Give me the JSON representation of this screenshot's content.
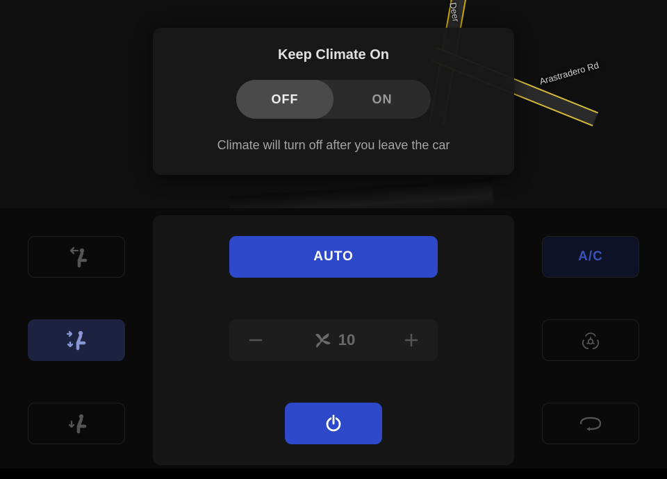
{
  "map": {
    "road1_label": "Deer",
    "road2_label": "Arastradero Rd"
  },
  "dialog": {
    "title": "Keep Climate On",
    "off_label": "OFF",
    "on_label": "ON",
    "selected": "off",
    "description": "Climate will turn off after you leave the car"
  },
  "climate": {
    "auto_label": "AUTO",
    "ac_label": "A/C",
    "fan_level": "10"
  }
}
